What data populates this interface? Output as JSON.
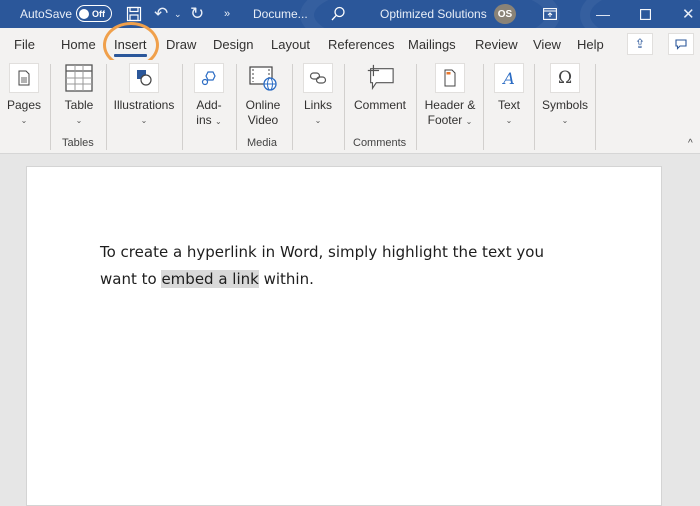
{
  "titlebar": {
    "autosave_label": "AutoSave",
    "autosave_state": "Off",
    "doc_title": "Docume...",
    "account_name": "Optimized Solutions",
    "avatar_initials": "OS",
    "brand_color": "#2b579a"
  },
  "tabs": [
    {
      "label": "File"
    },
    {
      "label": "Home"
    },
    {
      "label": "Insert",
      "active": true
    },
    {
      "label": "Draw"
    },
    {
      "label": "Design"
    },
    {
      "label": "Layout"
    },
    {
      "label": "References"
    },
    {
      "label": "Mailings"
    },
    {
      "label": "Review"
    },
    {
      "label": "View"
    },
    {
      "label": "Help"
    }
  ],
  "ribbon": {
    "buttons": {
      "pages": "Pages",
      "table": "Table",
      "illustrations": "Illustrations",
      "addins_1": "Add-",
      "addins_2": "ins",
      "online_video_1": "Online",
      "online_video_2": "Video",
      "links": "Links",
      "comment": "Comment",
      "header_footer_1": "Header &",
      "header_footer_2": "Footer",
      "text": "Text",
      "symbols": "Symbols"
    },
    "groups": {
      "tables": "Tables",
      "media": "Media",
      "comments": "Comments"
    }
  },
  "document": {
    "line1": "To create a hyperlink in Word, simply highlight the text you",
    "line2_before": "want to ",
    "line2_selected": "embed a link",
    "line2_after": " within."
  }
}
